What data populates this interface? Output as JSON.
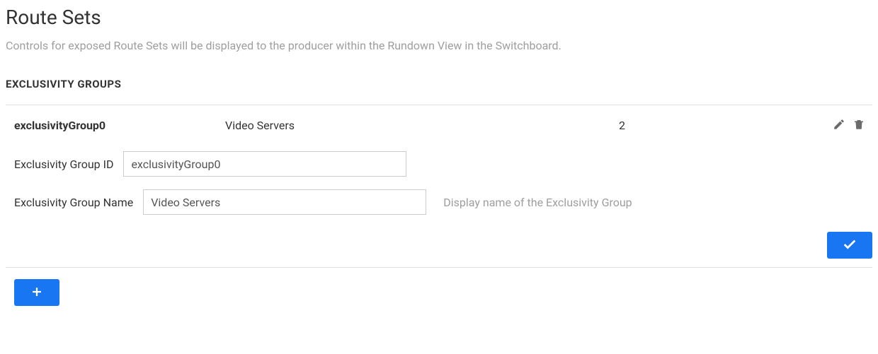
{
  "page": {
    "title": "Route Sets",
    "description": "Controls for exposed Route Sets will be displayed to the producer within the Rundown View in the Switchboard."
  },
  "section": {
    "header": "EXCLUSIVITY GROUPS"
  },
  "group": {
    "summary": {
      "id": "exclusivityGroup0",
      "name": "Video Servers",
      "count": "2"
    },
    "fields": {
      "id": {
        "label": "Exclusivity Group ID",
        "value": "exclusivityGroup0"
      },
      "name": {
        "label": "Exclusivity Group Name",
        "value": "Video Servers",
        "hint": "Display name of the Exclusivity Group"
      }
    }
  }
}
